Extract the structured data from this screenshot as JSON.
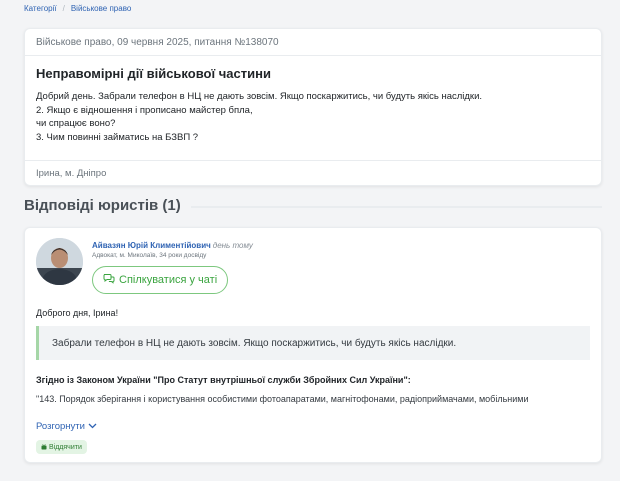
{
  "breadcrumb": {
    "items": [
      "Категорії",
      "Військове право"
    ],
    "separator": "/"
  },
  "question": {
    "meta": "Військове право, 09 червня 2025, питання №138070",
    "title": "Неправомірні дії військової частини",
    "lines": [
      "Добрий день. Забрали телефон в НЦ не дають зовсім. Якщо поскаржитись, чи будуть якісь наслідки.",
      "2. Якщо є відношення і прописано майстер бпла,",
      "чи спрацює воно?",
      "3. Чим повинні займатись на БЗВП ?"
    ],
    "author": "Ірина, м. Дніпро"
  },
  "answers": {
    "heading": "Відповіді юристів (1)",
    "items": [
      {
        "lawyer_name": "Айвазян Юрій Климентійович",
        "time_ago": "день тому",
        "meta": "Адвокат, м. Миколаїв, 34 роки досвіду",
        "chat_label": "Спілкуватися у чаті",
        "greeting": "Доброго дня, Ірина!",
        "quote": "Забрали телефон в НЦ не дають зовсім. Якщо поскаржитись, чи будуть якісь наслідки.",
        "law_heading": "Згідно із Законом України \"Про Статут внутрішньої служби Збройних Сил України\":",
        "law_text": "\"143. Порядок зберігання і користування особистими фотоапаратами, магнітофонами, радіоприймачами, мобільними",
        "expand_label": "Розгорнути",
        "badge_label": "Віддячити"
      }
    ]
  },
  "colors": {
    "link": "#2f63b3",
    "chat_green": "#3aa43f",
    "quote_border": "#a5d6a7",
    "background": "#f3f4f6"
  },
  "icons": {
    "chat": "chat-bubbles-icon",
    "expand": "chevron-down-icon",
    "badge": "thank-icon"
  }
}
